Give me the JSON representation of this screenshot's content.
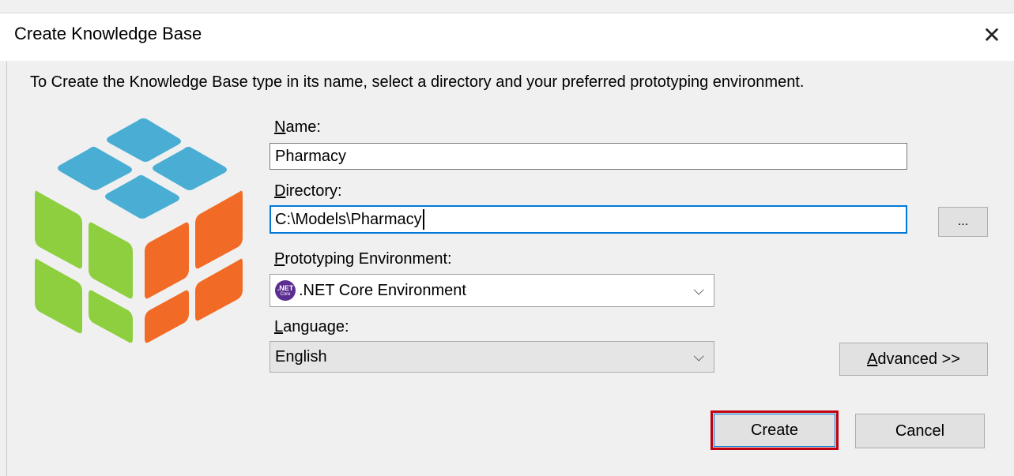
{
  "window": {
    "title": "Create Knowledge Base",
    "close_glyph": "✕"
  },
  "instructions": "To Create the Knowledge Base type in its name, select a directory and your preferred prototyping environment.",
  "logo": {
    "icon": "rubiks-cube-icon",
    "colors": {
      "top": "#4aaed4",
      "left": "#8dcf3f",
      "right": "#f26b26"
    }
  },
  "form": {
    "name": {
      "label_key": "N",
      "label_rest": "ame:",
      "value": "Pharmacy"
    },
    "directory": {
      "label_key": "D",
      "label_rest": "irectory:",
      "value": "C:\\Models\\Pharmacy",
      "browse_label": "..."
    },
    "environment": {
      "label_key": "P",
      "label_rest": "rototyping Environment:",
      "value": ".NET Core Environment",
      "icon": "dotnet-core-icon",
      "icon_text_top": ".NET",
      "icon_text_bottom": "Core"
    },
    "language": {
      "label_key": "L",
      "label_rest": "anguage:",
      "value": "English"
    }
  },
  "buttons": {
    "advanced_key": "A",
    "advanced_rest": "dvanced >>",
    "create": "Create",
    "cancel": "Cancel"
  },
  "colors": {
    "highlight_border": "#c0000f",
    "focus_border": "#0078d7"
  }
}
